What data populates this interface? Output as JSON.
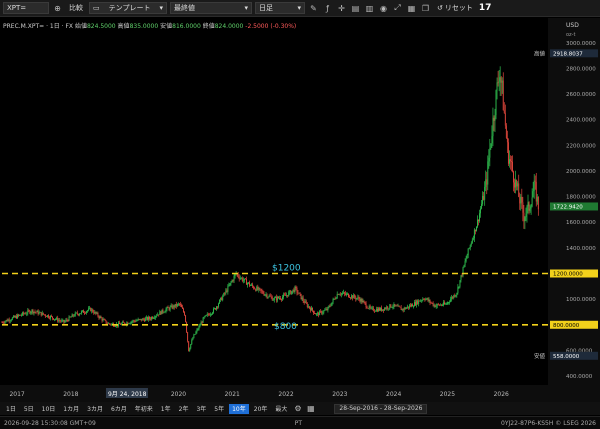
{
  "toolbar": {
    "symbol_value": "XPT=",
    "compare_label": "比較",
    "template_label": "テンプレート",
    "chart_type_label": "最終値",
    "interval_label": "日足",
    "undo_label": "リセット"
  },
  "info": {
    "symbol": "PREC.M.XPT=",
    "interval": "1日",
    "exchange": "FX",
    "open_label": "始値",
    "open": "824.5000",
    "high_label": "高値",
    "high": "835.0000",
    "low_label": "安値",
    "low": "816.0000",
    "close_label": "終値",
    "close": "824.0000",
    "change": "-2.5000 (-0.30%)"
  },
  "axis": {
    "currency": "USD",
    "scale": "oz-t",
    "high_tag": "高値",
    "low_tag": "安値",
    "high_value": "2918.8037",
    "low_value": "558.0000",
    "last_value": "1722.9420",
    "level_1200": "1200.0000",
    "level_800": "800.0000"
  },
  "annotations": {
    "line_upper": "$1200",
    "line_lower": "$800",
    "cursor_date": "9月 24, 2018"
  },
  "colors": {
    "up": "#2fbf4f",
    "down": "#e0473c",
    "dash": "#f2d11b",
    "annot": "#3cc3e0",
    "active": "#1f6fd6"
  },
  "bottom": {
    "ranges": [
      "1日",
      "5日",
      "10日",
      "1カ月",
      "3カ月",
      "6カ月",
      "年初来",
      "1年",
      "2年",
      "3年",
      "5年",
      "10年",
      "20年",
      "最大"
    ],
    "active_range": "10年",
    "date_range": "28-Sep-2016 - 28-Sep-2026"
  },
  "status": {
    "left": "2026-09-28 15:30:08 GMT+09",
    "center": "PT",
    "right": "0YJ22-87P6-KS5H    © LSEG 2026"
  },
  "chart_data": {
    "type": "line",
    "xlabel": "",
    "ylabel": "",
    "x_ticks": [
      "2017",
      "2018",
      "2019",
      "2020",
      "2021",
      "2022",
      "2023",
      "2024",
      "2025",
      "2026"
    ],
    "y_ticks": [
      400,
      600,
      800,
      1000,
      1200,
      1400,
      1600,
      1800,
      2000,
      2200,
      2400,
      2600,
      2800,
      3000
    ],
    "ylim": [
      330,
      3100
    ],
    "grid": false,
    "series": [
      {
        "values": [
          [
            2016.75,
            820
          ],
          [
            2017.0,
            860
          ],
          [
            2017.3,
            910
          ],
          [
            2017.6,
            870
          ],
          [
            2017.9,
            820
          ],
          [
            2018.1,
            880
          ],
          [
            2018.4,
            920
          ],
          [
            2018.7,
            810
          ],
          [
            2018.9,
            800
          ],
          [
            2019.2,
            830
          ],
          [
            2019.5,
            850
          ],
          [
            2019.8,
            920
          ],
          [
            2020.05,
            960
          ],
          [
            2020.15,
            880
          ],
          [
            2020.22,
            600
          ],
          [
            2020.3,
            700
          ],
          [
            2020.5,
            850
          ],
          [
            2020.7,
            920
          ],
          [
            2020.9,
            1050
          ],
          [
            2021.1,
            1200
          ],
          [
            2021.2,
            1160
          ],
          [
            2021.4,
            1100
          ],
          [
            2021.6,
            1050
          ],
          [
            2021.8,
            1000
          ],
          [
            2022.0,
            1020
          ],
          [
            2022.2,
            1080
          ],
          [
            2022.4,
            960
          ],
          [
            2022.6,
            880
          ],
          [
            2022.8,
            920
          ],
          [
            2023.0,
            1050
          ],
          [
            2023.2,
            1030
          ],
          [
            2023.4,
            1000
          ],
          [
            2023.6,
            920
          ],
          [
            2023.8,
            920
          ],
          [
            2024.0,
            950
          ],
          [
            2024.2,
            920
          ],
          [
            2024.4,
            960
          ],
          [
            2024.6,
            1010
          ],
          [
            2024.8,
            950
          ],
          [
            2025.0,
            960
          ],
          [
            2025.2,
            1050
          ],
          [
            2025.4,
            1350
          ],
          [
            2025.6,
            1620
          ],
          [
            2025.75,
            1900
          ],
          [
            2025.85,
            2300
          ],
          [
            2026.0,
            2800
          ],
          [
            2026.05,
            2620
          ],
          [
            2026.15,
            2150
          ],
          [
            2026.3,
            1900
          ],
          [
            2026.45,
            1650
          ],
          [
            2026.55,
            1720
          ],
          [
            2026.65,
            1880
          ],
          [
            2026.72,
            1723
          ]
        ]
      }
    ],
    "reference_lines": [
      1200,
      800
    ]
  }
}
